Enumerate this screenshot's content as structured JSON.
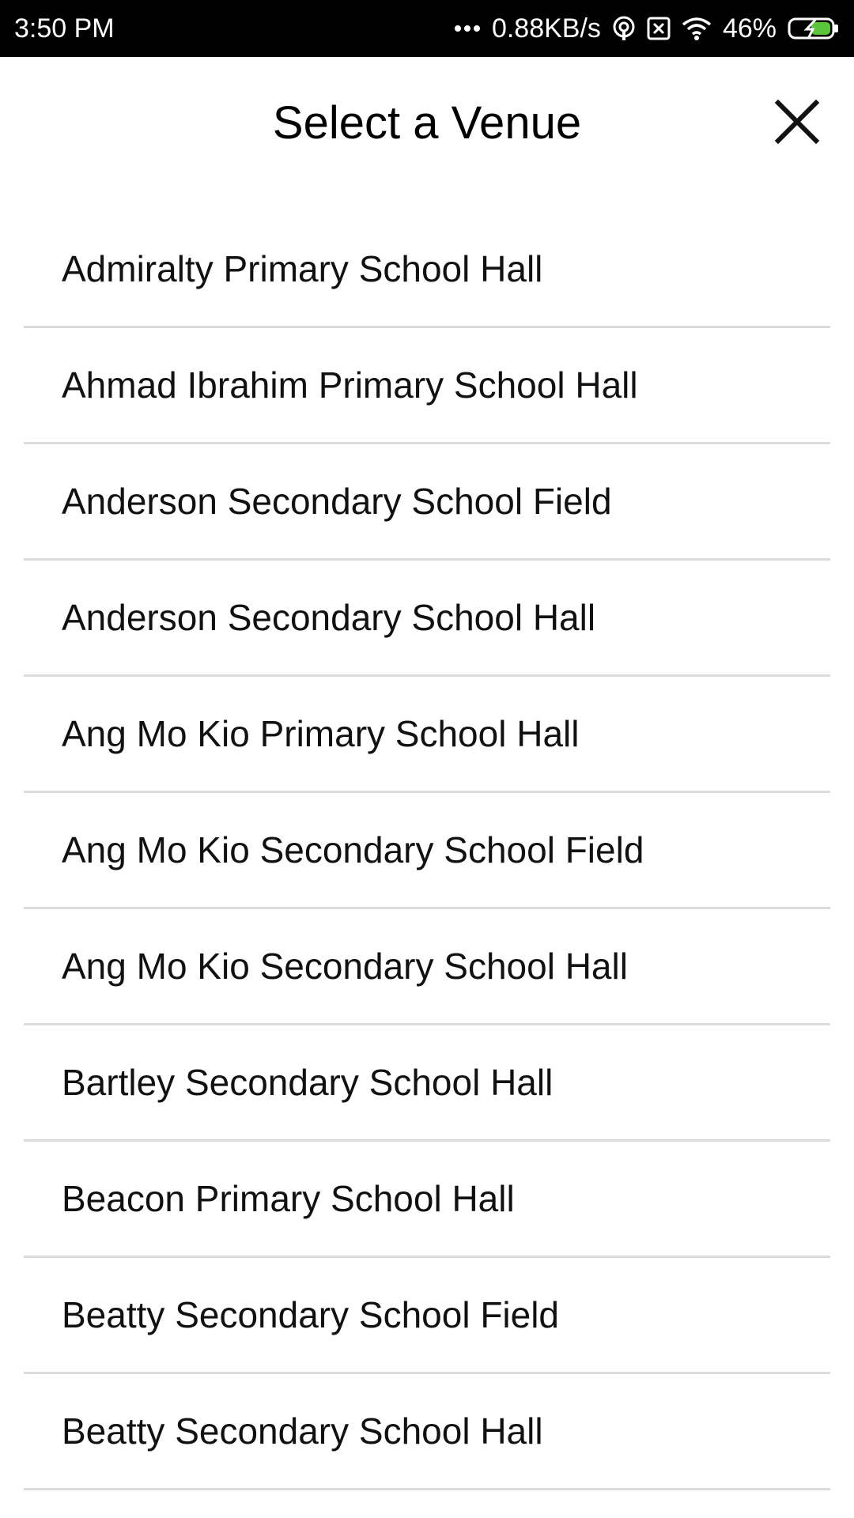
{
  "status_bar": {
    "time": "3:50 PM",
    "network_speed": "0.88KB/s",
    "battery": "46%",
    "icons": [
      "dots-icon",
      "hotspot-icon",
      "sim-off-icon",
      "wifi-icon",
      "battery-charging-icon"
    ]
  },
  "header": {
    "title": "Select a Venue",
    "close_icon": "close-icon"
  },
  "venues": [
    "Admiralty Primary School Hall",
    "Ahmad Ibrahim Primary School Hall",
    "Anderson Secondary School Field",
    "Anderson Secondary School Hall",
    "Ang Mo Kio Primary School Hall",
    "Ang Mo Kio Secondary School Field",
    "Ang Mo Kio Secondary School Hall",
    "Bartley Secondary School Hall",
    "Beacon Primary School Hall",
    "Beatty Secondary School Field",
    "Beatty Secondary School Hall"
  ],
  "colors": {
    "status_bar_bg": "#000000",
    "background": "#ffffff",
    "divider": "#dcdcdc",
    "battery_charge": "#5cc43a"
  }
}
